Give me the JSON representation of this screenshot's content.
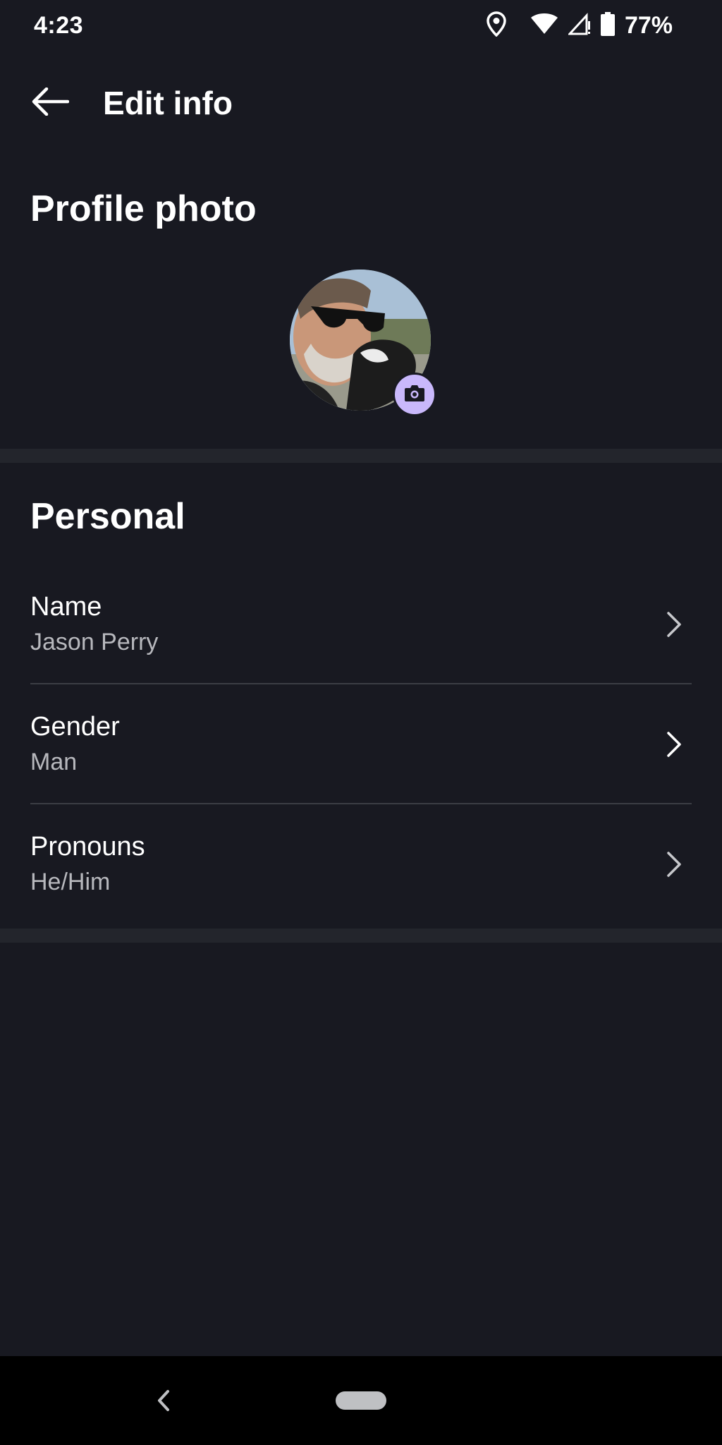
{
  "status_bar": {
    "time": "4:23",
    "battery": "77%",
    "icons": [
      "location-icon",
      "wifi-icon",
      "cell-signal-icon",
      "battery-icon"
    ]
  },
  "app_bar": {
    "title": "Edit info",
    "back_icon": "arrow-left-icon"
  },
  "profile": {
    "section_title": "Profile photo",
    "camera_icon": "camera-icon"
  },
  "personal": {
    "section_title": "Personal",
    "items": [
      {
        "label": "Name",
        "value": "Jason Perry"
      },
      {
        "label": "Gender",
        "value": "Man"
      },
      {
        "label": "Pronouns",
        "value": "He/Him"
      }
    ]
  },
  "colors": {
    "background": "#181921",
    "accent": "#c9b8fb",
    "secondary_text": "#b7b8bd"
  }
}
